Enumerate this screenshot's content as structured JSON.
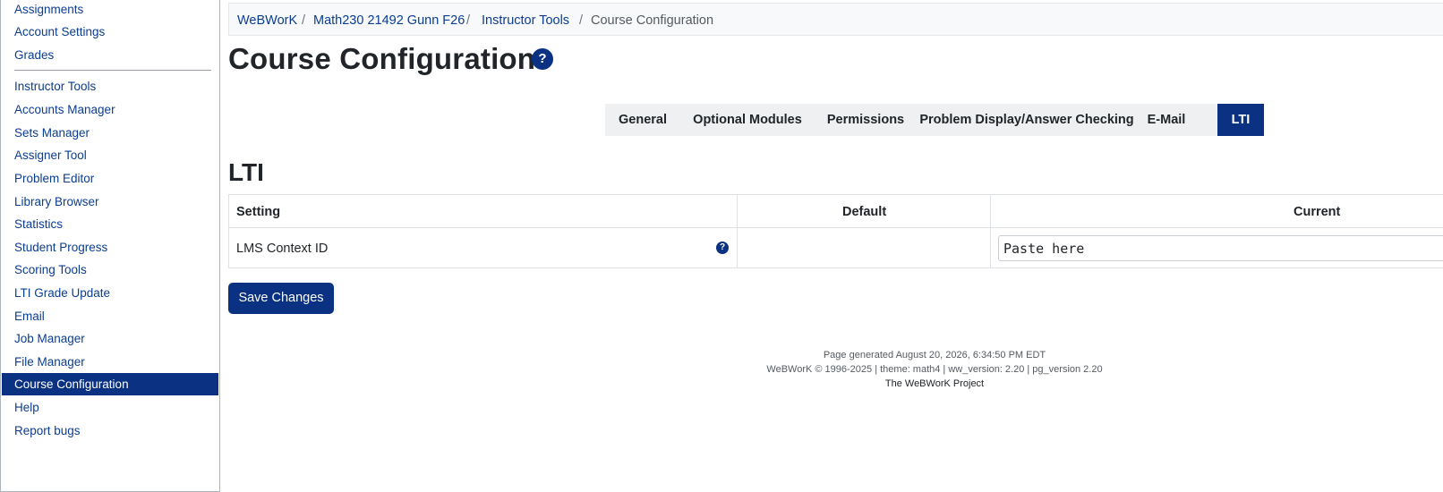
{
  "sidebar": {
    "items": [
      {
        "label": "Assignments"
      },
      {
        "label": "Account Settings"
      },
      {
        "label": "Grades"
      },
      {
        "label": "Instructor Tools"
      },
      {
        "label": "Accounts Manager"
      },
      {
        "label": "Sets Manager"
      },
      {
        "label": "Assigner Tool"
      },
      {
        "label": "Problem Editor"
      },
      {
        "label": "Library Browser"
      },
      {
        "label": "Statistics"
      },
      {
        "label": "Student Progress"
      },
      {
        "label": "Scoring Tools"
      },
      {
        "label": "LTI Grade Update"
      },
      {
        "label": "Email"
      },
      {
        "label": "Job Manager"
      },
      {
        "label": "File Manager"
      },
      {
        "label": "Course Configuration",
        "active": true
      },
      {
        "label": "Help"
      },
      {
        "label": "Report bugs"
      }
    ]
  },
  "breadcrumb": {
    "items": [
      "WeBWorK",
      "Math230 21492 Gunn F26",
      "Instructor Tools",
      "Course Configuration"
    ],
    "separator": "/"
  },
  "page": {
    "title": "Course Configuration",
    "help_glyph": "?"
  },
  "tabs": [
    {
      "label": "General"
    },
    {
      "label": "Optional Modules"
    },
    {
      "label": "Permissions"
    },
    {
      "label": "Problem Display/Answer Checking"
    },
    {
      "label": "E-Mail"
    },
    {
      "label": "LTI",
      "active": true
    }
  ],
  "section": {
    "title": "LTI",
    "table": {
      "headers": [
        "Setting",
        "Default",
        "Current"
      ],
      "rows": [
        {
          "setting": "LMS Context ID",
          "default": "",
          "current_placeholder": "Paste here",
          "help_glyph": "?"
        }
      ]
    }
  },
  "actions": {
    "save_label": "Save Changes"
  },
  "footer": {
    "generated": "Page generated August 20, 2026, 6:34:50 PM EDT",
    "versions": "WeBWorK © 1996-2025 | theme: math4 | ww_version: 2.20 | pg_version 2.20",
    "project": "The WeBWorK Project"
  },
  "colors": {
    "accent": "#0a3182",
    "link": "#0b3d91"
  },
  "icons": {
    "page_help": "help-icon",
    "setting_help": "help-icon"
  }
}
